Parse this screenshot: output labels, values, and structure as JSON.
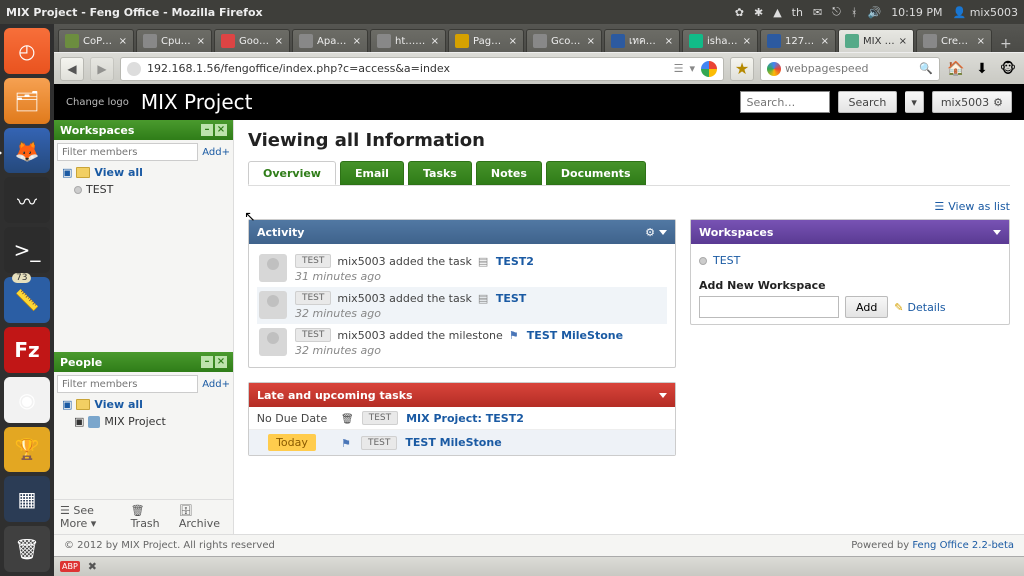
{
  "system": {
    "window_title": "MIX Project - Feng Office - Mozilla Firefox",
    "clock": "10:19 PM",
    "user": "mix5003"
  },
  "browser_tabs": [
    {
      "label": "CoPr…",
      "bg": "#6c8d3f"
    },
    {
      "label": "CpuR…",
      "bg": "#888"
    },
    {
      "label": "Goog…",
      "bg": "#d44"
    },
    {
      "label": "Apac…",
      "bg": "#888"
    },
    {
      "label": "ht…ml",
      "bg": "#888"
    },
    {
      "label": "Page…",
      "bg": "#d6a100"
    },
    {
      "label": "Gcon…",
      "bg": "#888"
    },
    {
      "label": "เทคน…",
      "bg": "#2c5aa0"
    },
    {
      "label": "ishar…",
      "bg": "#1b8"
    },
    {
      "label": "127.0…",
      "bg": "#2c5aa0"
    },
    {
      "label": "MIX …",
      "bg": "#5a8"
    },
    {
      "label": "Crea…",
      "bg": "#888"
    }
  ],
  "active_tab_index": 10,
  "addressbar": {
    "url": "192.168.1.56/fengoffice/index.php?c=access&a=index",
    "search_placeholder": "webpagespeed"
  },
  "blackbar": {
    "change_logo": "Change logo",
    "project_name": "MIX Project",
    "search_placeholder": "Search…",
    "search_btn": "Search",
    "user": "mix5003"
  },
  "sidebar": {
    "workspaces": {
      "title": "Workspaces",
      "filter_placeholder": "Filter members",
      "add": "Add+",
      "view_all": "View all",
      "items": [
        "TEST"
      ]
    },
    "people": {
      "title": "People",
      "filter_placeholder": "Filter members",
      "add": "Add+",
      "view_all": "View all",
      "items": [
        "MIX Project"
      ]
    },
    "footer": {
      "see_more": "See More",
      "trash": "Trash",
      "archive": "Archive"
    }
  },
  "main": {
    "heading": "Viewing all Information",
    "tabs": [
      "Overview",
      "Email",
      "Tasks",
      "Notes",
      "Documents"
    ],
    "active_tab": 0,
    "view_as_list": "View as list",
    "activity": {
      "title": "Activity",
      "rows": [
        {
          "ws": "TEST",
          "text": "mix5003 added the task",
          "ico": "note",
          "link": "TEST2",
          "time": "31 minutes ago",
          "alt": false
        },
        {
          "ws": "TEST",
          "text": "mix5003 added the task",
          "ico": "note",
          "link": "TEST",
          "time": "32 minutes ago",
          "alt": true
        },
        {
          "ws": "TEST",
          "text": "mix5003 added the milestone",
          "ico": "flag",
          "link": "TEST MileStone",
          "time": "32 minutes ago",
          "alt": false
        }
      ]
    },
    "late": {
      "title": "Late and upcoming tasks",
      "rows": [
        {
          "date": "No Due Date",
          "ico": "trash",
          "ws": "TEST",
          "proj": "MIX Project:",
          "task": "TEST2",
          "today": false
        },
        {
          "date": "Today",
          "ico": "flag",
          "ws": "TEST",
          "proj": "",
          "task": "TEST MileStone",
          "today": true
        }
      ]
    },
    "workspaces_panel": {
      "title": "Workspaces",
      "items": [
        "TEST"
      ],
      "add_label": "Add New Workspace",
      "add_btn": "Add",
      "details": "Details"
    }
  },
  "page_footer": {
    "copyright": "© 2012 by MIX Project. All rights reserved",
    "powered": "Powered by ",
    "powered_link": "Feng Office 2.2-beta"
  }
}
